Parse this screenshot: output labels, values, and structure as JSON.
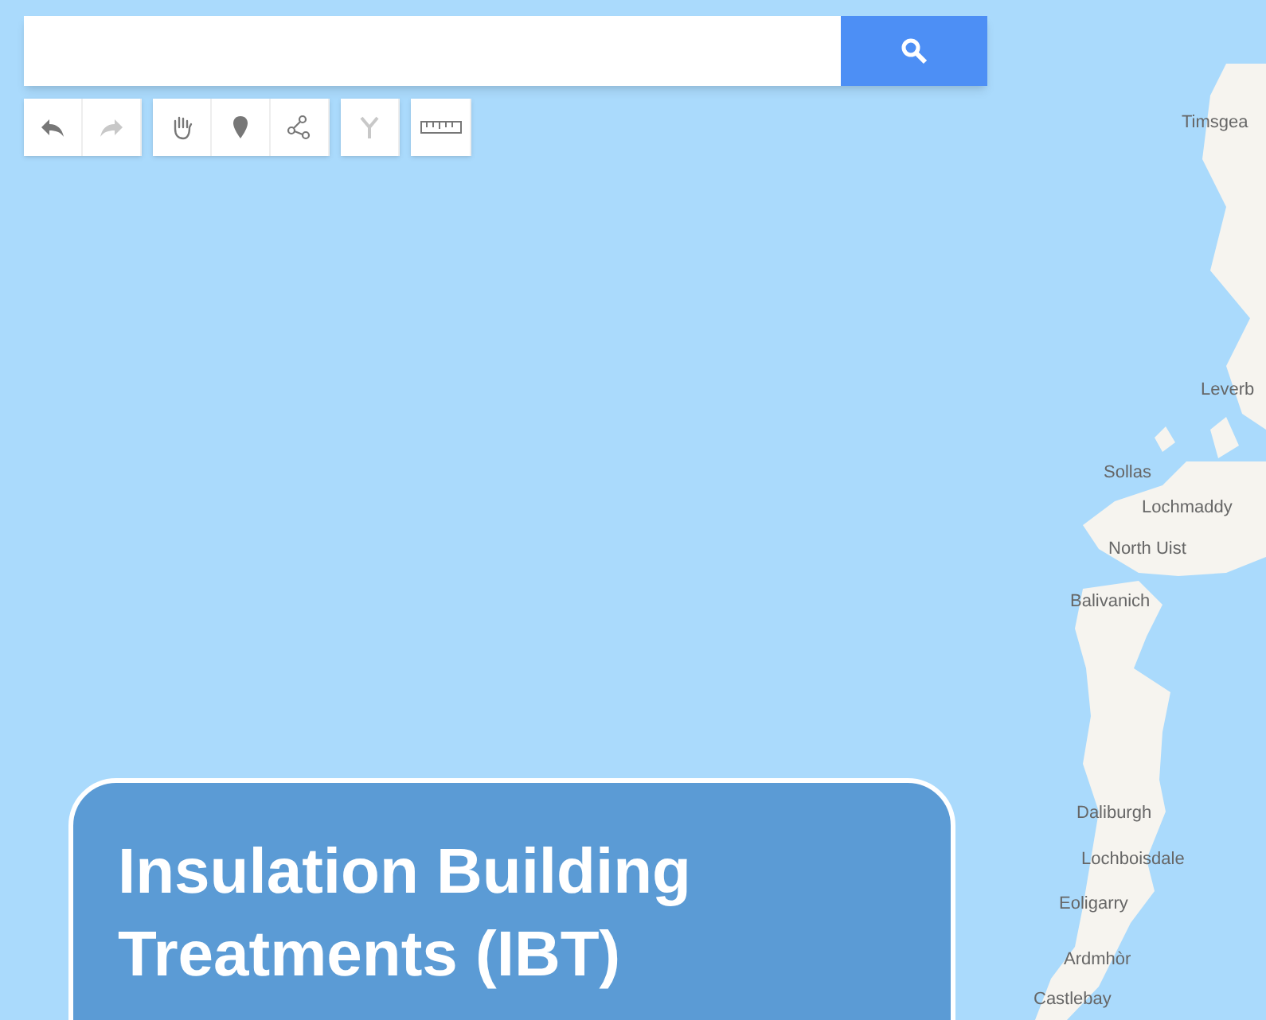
{
  "toolbar": [
    {
      "tools": [
        {
          "kind": "undo",
          "disabled": false
        },
        {
          "kind": "redo",
          "disabled": true
        }
      ]
    },
    {
      "tools": [
        {
          "kind": "hand",
          "disabled": false
        },
        {
          "kind": "marker",
          "disabled": false
        },
        {
          "kind": "line",
          "disabled": false
        }
      ]
    },
    {
      "tools": [
        {
          "kind": "route",
          "disabled": true
        }
      ]
    },
    {
      "tools": [
        {
          "kind": "ruler",
          "disabled": false
        }
      ]
    }
  ],
  "map_labels": [
    "Timsgea",
    "Leverb",
    "Sollas",
    "Lochmaddy",
    "North Uist",
    "Balivanich",
    "Daliburgh",
    "Lochboisdale",
    "Eoligarry",
    "Ardmhòr",
    "Castlebay"
  ],
  "card": {
    "title": "Insulation Building Treatments (IBT)"
  }
}
